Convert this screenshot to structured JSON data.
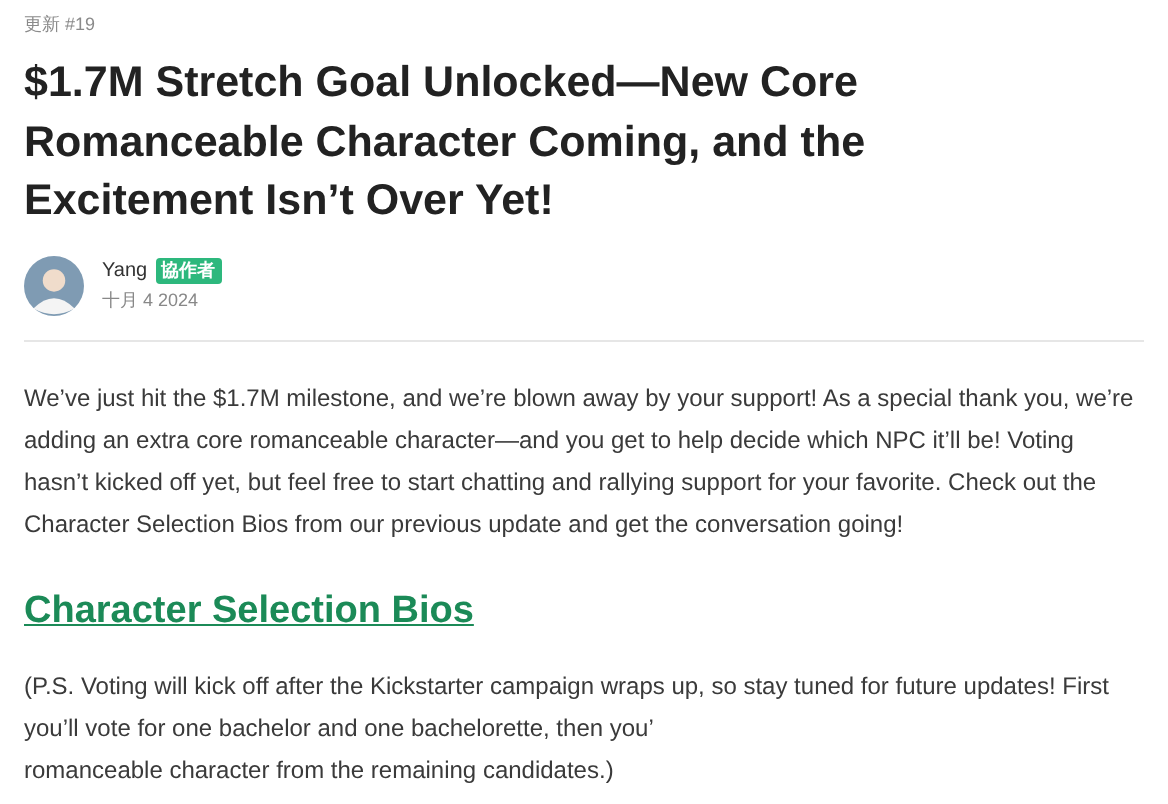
{
  "update_label": "更新 #19",
  "title": "$1.7M Stretch Goal Unlocked—New Core Romanceable Character Coming, and the Excitement Isn’t Over Yet!",
  "author": {
    "name": "Yang",
    "badge": "協作者",
    "date": "十月 4 2024"
  },
  "body": "We’ve just hit the $1.7M milestone, and we’re blown away by your support! As a special thank you, we’re adding an extra core romanceable character—and you get to help decide which NPC it’ll be! Voting hasn’t kicked off yet, but feel free to start chatting and rallying support for your favorite. Check out the Character Selection Bios from our previous update and get the conversation going!",
  "heading": "Character Selection Bios",
  "ps_lines": [
    "(P.S. Voting will kick off after the Kickstarter campaign wraps up, so stay tuned for future updates! First",
    "you’ll vote for one bachelor and one bachelorette, then you’",
    "romanceable character from the remaining candidates.)"
  ]
}
